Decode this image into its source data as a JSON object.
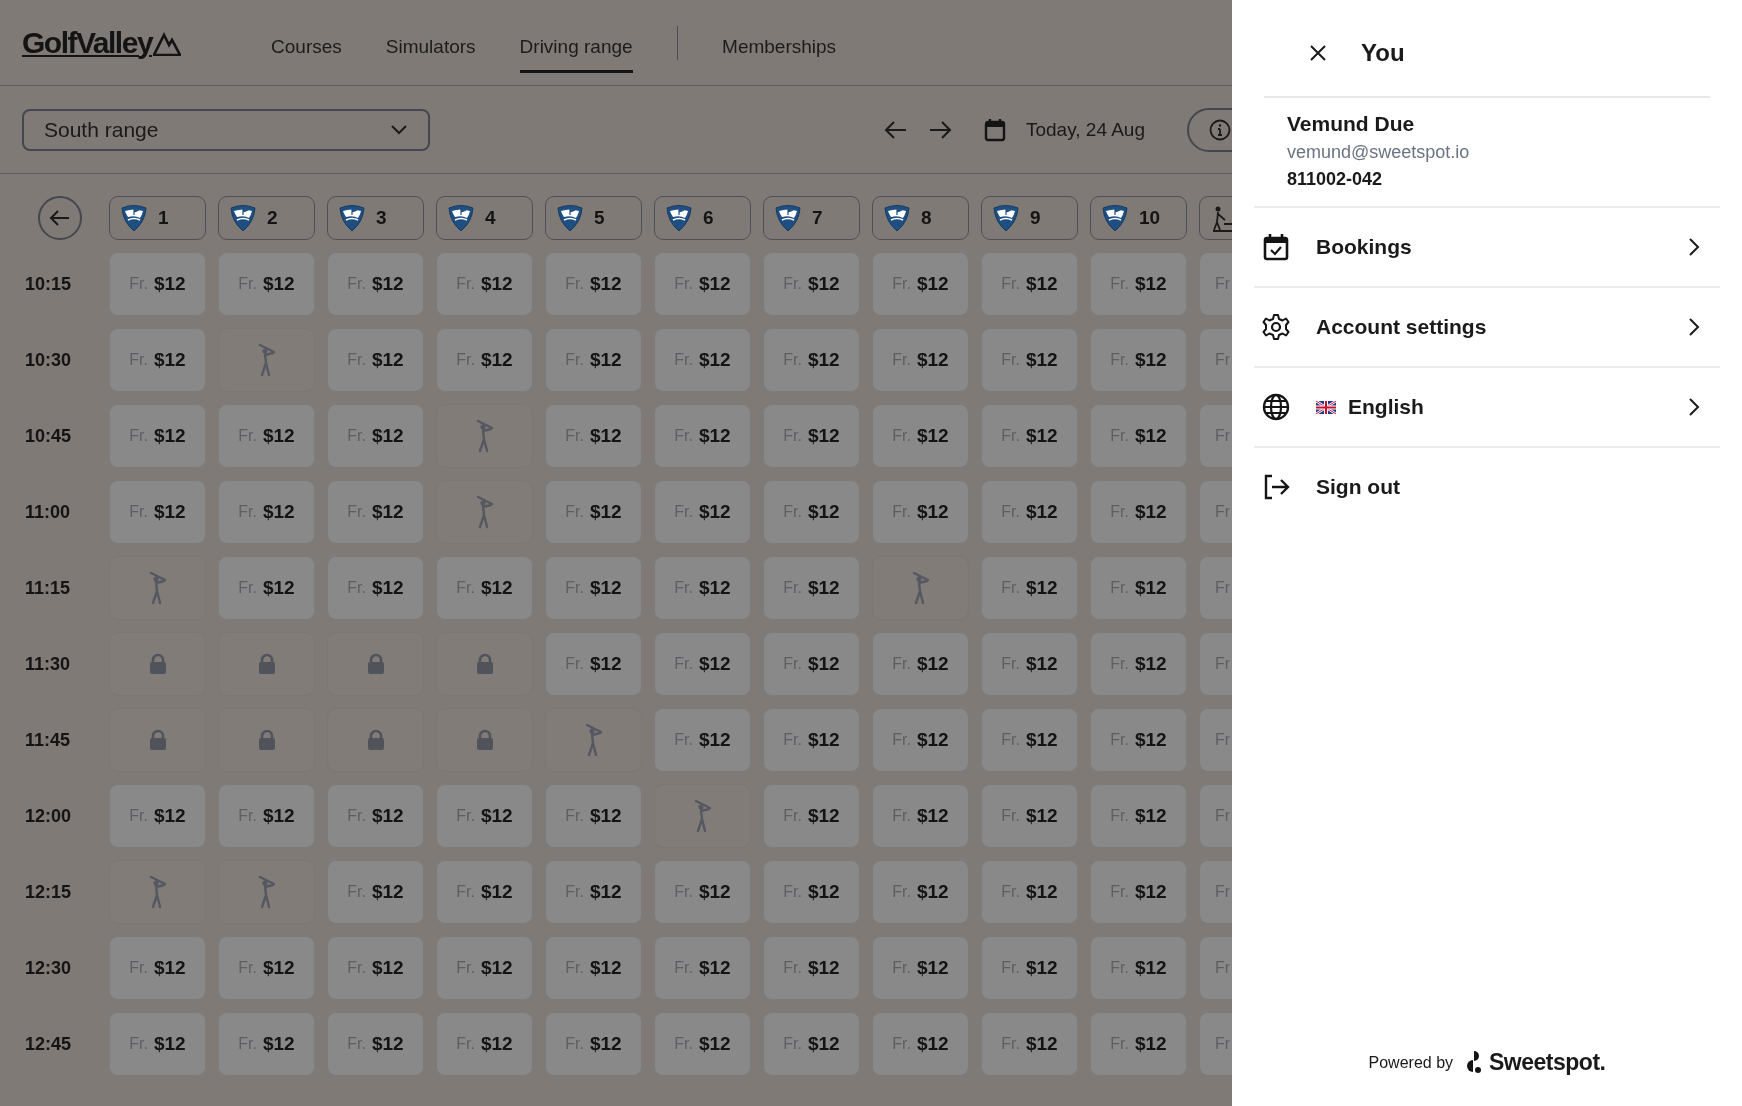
{
  "header": {
    "logo": "GolfValley",
    "nav": [
      {
        "label": "Courses",
        "selected": false
      },
      {
        "label": "Simulators",
        "selected": false
      },
      {
        "label": "Driving range",
        "selected": true
      }
    ],
    "nav_secondary": [
      {
        "label": "Memberships",
        "selected": false
      }
    ]
  },
  "toolbar": {
    "range_select": {
      "value": "South range"
    },
    "date": "Today, 24 Aug"
  },
  "bays": [
    {
      "kind": "shield",
      "label": "1"
    },
    {
      "kind": "shield",
      "label": "2"
    },
    {
      "kind": "shield",
      "label": "3"
    },
    {
      "kind": "shield",
      "label": "4"
    },
    {
      "kind": "shield",
      "label": "5"
    },
    {
      "kind": "shield",
      "label": "6"
    },
    {
      "kind": "shield",
      "label": "7"
    },
    {
      "kind": "shield",
      "label": "8"
    },
    {
      "kind": "shield",
      "label": "9"
    },
    {
      "kind": "shield",
      "label": "10"
    },
    {
      "kind": "walker"
    }
  ],
  "slots": [
    {
      "time": "10:15",
      "cells": [
        {
          "kind": "price",
          "prefix": "Fr.",
          "price": "$12"
        },
        {
          "kind": "price",
          "prefix": "Fr.",
          "price": "$12"
        },
        {
          "kind": "price",
          "prefix": "Fr.",
          "price": "$12"
        },
        {
          "kind": "price",
          "prefix": "Fr.",
          "price": "$12"
        },
        {
          "kind": "price",
          "prefix": "Fr.",
          "price": "$12"
        },
        {
          "kind": "price",
          "prefix": "Fr.",
          "price": "$12"
        },
        {
          "kind": "price",
          "prefix": "Fr.",
          "price": "$12"
        },
        {
          "kind": "price",
          "prefix": "Fr.",
          "price": "$12"
        },
        {
          "kind": "price",
          "prefix": "Fr.",
          "price": "$12"
        },
        {
          "kind": "price",
          "prefix": "Fr.",
          "price": "$12"
        },
        {
          "kind": "price",
          "prefix": "Fr"
        }
      ]
    },
    {
      "time": "10:30",
      "cells": [
        {
          "kind": "price",
          "prefix": "Fr.",
          "price": "$12"
        },
        {
          "kind": "booked"
        },
        {
          "kind": "price",
          "prefix": "Fr.",
          "price": "$12"
        },
        {
          "kind": "price",
          "prefix": "Fr.",
          "price": "$12"
        },
        {
          "kind": "price",
          "prefix": "Fr.",
          "price": "$12"
        },
        {
          "kind": "price",
          "prefix": "Fr.",
          "price": "$12"
        },
        {
          "kind": "price",
          "prefix": "Fr.",
          "price": "$12"
        },
        {
          "kind": "price",
          "prefix": "Fr.",
          "price": "$12"
        },
        {
          "kind": "price",
          "prefix": "Fr.",
          "price": "$12"
        },
        {
          "kind": "price",
          "prefix": "Fr.",
          "price": "$12"
        },
        {
          "kind": "price",
          "prefix": "Fr"
        }
      ]
    },
    {
      "time": "10:45",
      "cells": [
        {
          "kind": "price",
          "prefix": "Fr.",
          "price": "$12"
        },
        {
          "kind": "price",
          "prefix": "Fr.",
          "price": "$12"
        },
        {
          "kind": "price",
          "prefix": "Fr.",
          "price": "$12"
        },
        {
          "kind": "booked"
        },
        {
          "kind": "price",
          "prefix": "Fr.",
          "price": "$12"
        },
        {
          "kind": "price",
          "prefix": "Fr.",
          "price": "$12"
        },
        {
          "kind": "price",
          "prefix": "Fr.",
          "price": "$12"
        },
        {
          "kind": "price",
          "prefix": "Fr.",
          "price": "$12"
        },
        {
          "kind": "price",
          "prefix": "Fr.",
          "price": "$12"
        },
        {
          "kind": "price",
          "prefix": "Fr.",
          "price": "$12"
        },
        {
          "kind": "price",
          "prefix": "Fr"
        }
      ]
    },
    {
      "time": "11:00",
      "cells": [
        {
          "kind": "price",
          "prefix": "Fr.",
          "price": "$12"
        },
        {
          "kind": "price",
          "prefix": "Fr.",
          "price": "$12"
        },
        {
          "kind": "price",
          "prefix": "Fr.",
          "price": "$12"
        },
        {
          "kind": "booked"
        },
        {
          "kind": "price",
          "prefix": "Fr.",
          "price": "$12"
        },
        {
          "kind": "price",
          "prefix": "Fr.",
          "price": "$12"
        },
        {
          "kind": "price",
          "prefix": "Fr.",
          "price": "$12"
        },
        {
          "kind": "price",
          "prefix": "Fr.",
          "price": "$12"
        },
        {
          "kind": "price",
          "prefix": "Fr.",
          "price": "$12"
        },
        {
          "kind": "price",
          "prefix": "Fr.",
          "price": "$12"
        },
        {
          "kind": "price",
          "prefix": "Fr"
        }
      ]
    },
    {
      "time": "11:15",
      "cells": [
        {
          "kind": "booked"
        },
        {
          "kind": "price",
          "prefix": "Fr.",
          "price": "$12"
        },
        {
          "kind": "price",
          "prefix": "Fr.",
          "price": "$12"
        },
        {
          "kind": "price",
          "prefix": "Fr.",
          "price": "$12"
        },
        {
          "kind": "price",
          "prefix": "Fr.",
          "price": "$12"
        },
        {
          "kind": "price",
          "prefix": "Fr.",
          "price": "$12"
        },
        {
          "kind": "price",
          "prefix": "Fr.",
          "price": "$12"
        },
        {
          "kind": "booked"
        },
        {
          "kind": "price",
          "prefix": "Fr.",
          "price": "$12"
        },
        {
          "kind": "price",
          "prefix": "Fr.",
          "price": "$12"
        },
        {
          "kind": "price",
          "prefix": "Fr"
        }
      ]
    },
    {
      "time": "11:30",
      "cells": [
        {
          "kind": "locked"
        },
        {
          "kind": "locked"
        },
        {
          "kind": "locked"
        },
        {
          "kind": "locked"
        },
        {
          "kind": "price",
          "prefix": "Fr.",
          "price": "$12"
        },
        {
          "kind": "price",
          "prefix": "Fr.",
          "price": "$12"
        },
        {
          "kind": "price",
          "prefix": "Fr.",
          "price": "$12"
        },
        {
          "kind": "price",
          "prefix": "Fr.",
          "price": "$12"
        },
        {
          "kind": "price",
          "prefix": "Fr.",
          "price": "$12"
        },
        {
          "kind": "price",
          "prefix": "Fr.",
          "price": "$12"
        },
        {
          "kind": "price",
          "prefix": "Fr"
        }
      ]
    },
    {
      "time": "11:45",
      "cells": [
        {
          "kind": "locked"
        },
        {
          "kind": "locked"
        },
        {
          "kind": "locked"
        },
        {
          "kind": "locked"
        },
        {
          "kind": "booked"
        },
        {
          "kind": "price",
          "prefix": "Fr.",
          "price": "$12"
        },
        {
          "kind": "price",
          "prefix": "Fr.",
          "price": "$12"
        },
        {
          "kind": "price",
          "prefix": "Fr.",
          "price": "$12"
        },
        {
          "kind": "price",
          "prefix": "Fr.",
          "price": "$12"
        },
        {
          "kind": "price",
          "prefix": "Fr.",
          "price": "$12"
        },
        {
          "kind": "price",
          "prefix": "Fr"
        }
      ]
    },
    {
      "time": "12:00",
      "cells": [
        {
          "kind": "price",
          "prefix": "Fr.",
          "price": "$12"
        },
        {
          "kind": "price",
          "prefix": "Fr.",
          "price": "$12"
        },
        {
          "kind": "price",
          "prefix": "Fr.",
          "price": "$12"
        },
        {
          "kind": "price",
          "prefix": "Fr.",
          "price": "$12"
        },
        {
          "kind": "price",
          "prefix": "Fr.",
          "price": "$12"
        },
        {
          "kind": "booked"
        },
        {
          "kind": "price",
          "prefix": "Fr.",
          "price": "$12"
        },
        {
          "kind": "price",
          "prefix": "Fr.",
          "price": "$12"
        },
        {
          "kind": "price",
          "prefix": "Fr.",
          "price": "$12"
        },
        {
          "kind": "price",
          "prefix": "Fr.",
          "price": "$12"
        },
        {
          "kind": "price",
          "prefix": "Fr"
        }
      ]
    },
    {
      "time": "12:15",
      "cells": [
        {
          "kind": "booked"
        },
        {
          "kind": "booked"
        },
        {
          "kind": "price",
          "prefix": "Fr.",
          "price": "$12"
        },
        {
          "kind": "price",
          "prefix": "Fr.",
          "price": "$12"
        },
        {
          "kind": "price",
          "prefix": "Fr.",
          "price": "$12"
        },
        {
          "kind": "price",
          "prefix": "Fr.",
          "price": "$12"
        },
        {
          "kind": "price",
          "prefix": "Fr.",
          "price": "$12"
        },
        {
          "kind": "price",
          "prefix": "Fr.",
          "price": "$12"
        },
        {
          "kind": "price",
          "prefix": "Fr.",
          "price": "$12"
        },
        {
          "kind": "price",
          "prefix": "Fr.",
          "price": "$12"
        },
        {
          "kind": "price",
          "prefix": "Fr"
        }
      ]
    },
    {
      "time": "12:30",
      "cells": [
        {
          "kind": "price",
          "prefix": "Fr.",
          "price": "$12"
        },
        {
          "kind": "price",
          "prefix": "Fr.",
          "price": "$12"
        },
        {
          "kind": "price",
          "prefix": "Fr.",
          "price": "$12"
        },
        {
          "kind": "price",
          "prefix": "Fr.",
          "price": "$12"
        },
        {
          "kind": "price",
          "prefix": "Fr.",
          "price": "$12"
        },
        {
          "kind": "price",
          "prefix": "Fr.",
          "price": "$12"
        },
        {
          "kind": "price",
          "prefix": "Fr.",
          "price": "$12"
        },
        {
          "kind": "price",
          "prefix": "Fr.",
          "price": "$12"
        },
        {
          "kind": "price",
          "prefix": "Fr.",
          "price": "$12"
        },
        {
          "kind": "price",
          "prefix": "Fr.",
          "price": "$12"
        },
        {
          "kind": "price",
          "prefix": "Fr"
        }
      ]
    },
    {
      "time": "12:45",
      "cells": [
        {
          "kind": "price",
          "prefix": "Fr.",
          "price": "$12"
        },
        {
          "kind": "price",
          "prefix": "Fr.",
          "price": "$12"
        },
        {
          "kind": "price",
          "prefix": "Fr.",
          "price": "$12"
        },
        {
          "kind": "price",
          "prefix": "Fr.",
          "price": "$12"
        },
        {
          "kind": "price",
          "prefix": "Fr.",
          "price": "$12"
        },
        {
          "kind": "price",
          "prefix": "Fr.",
          "price": "$12"
        },
        {
          "kind": "price",
          "prefix": "Fr.",
          "price": "$12"
        },
        {
          "kind": "price",
          "prefix": "Fr.",
          "price": "$12"
        },
        {
          "kind": "price",
          "prefix": "Fr.",
          "price": "$12"
        },
        {
          "kind": "price",
          "prefix": "Fr.",
          "price": "$12"
        },
        {
          "kind": "price",
          "prefix": "Fr"
        }
      ]
    }
  ],
  "panel": {
    "title": "You",
    "user": {
      "name": "Vemund Due",
      "email": "vemund@sweetspot.io",
      "member_number": "811002-042"
    },
    "menu": [
      {
        "kind": "bookings",
        "label": "Bookings",
        "chevron": true
      },
      {
        "kind": "settings",
        "label": "Account settings",
        "chevron": true
      },
      {
        "kind": "language",
        "label": "English",
        "chevron": true
      },
      {
        "kind": "signout",
        "label": "Sign out",
        "chevron": false
      }
    ],
    "footer": {
      "powered_by": "Powered by",
      "brand": "Sweetspot."
    }
  }
}
